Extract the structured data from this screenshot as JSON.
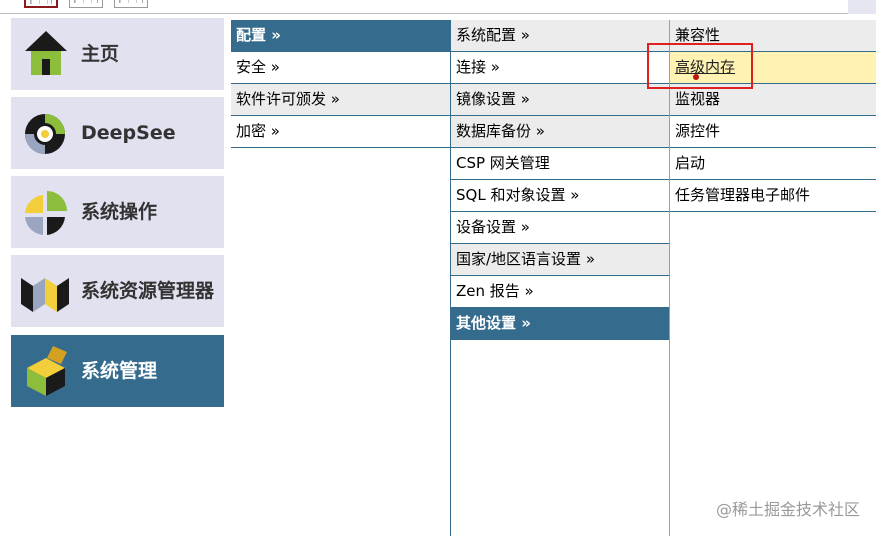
{
  "nav": {
    "items": [
      {
        "label": "主页",
        "icon": "home-icon",
        "active": false
      },
      {
        "label": "DeepSee",
        "icon": "deepsee-icon",
        "active": false
      },
      {
        "label": "系统操作",
        "icon": "system-operation-icon",
        "active": false
      },
      {
        "label": "系统资源管理器",
        "icon": "system-explorer-icon",
        "active": false
      },
      {
        "label": "系统管理",
        "icon": "system-admin-icon",
        "active": true
      }
    ]
  },
  "menu": {
    "col1": [
      {
        "label": "配置 »"
      },
      {
        "label": "安全 »"
      },
      {
        "label": "软件许可颁发 »"
      },
      {
        "label": "加密 »"
      }
    ],
    "col2": [
      {
        "label": "系统配置 »"
      },
      {
        "label": "连接 »"
      },
      {
        "label": "镜像设置 »"
      },
      {
        "label": "数据库备份 »"
      },
      {
        "label": "CSP 网关管理"
      },
      {
        "label": "SQL 和对象设置 »"
      },
      {
        "label": "设备设置 »"
      },
      {
        "label": "国家/地区语言设置 »"
      },
      {
        "label": "Zen 报告 »"
      },
      {
        "label": "其他设置 »"
      }
    ],
    "col3": [
      {
        "label": "兼容性"
      },
      {
        "label": "高级内存"
      },
      {
        "label": "监视器"
      },
      {
        "label": "源控件"
      },
      {
        "label": "启动"
      },
      {
        "label": "任务管理器电子邮件"
      }
    ]
  },
  "colors": {
    "accent": "#356b8c",
    "tile_bg": "#e1e1ef",
    "highlight": "#fff2b3",
    "annotation": "#e02020"
  },
  "watermark": "@稀土掘金技术社区"
}
